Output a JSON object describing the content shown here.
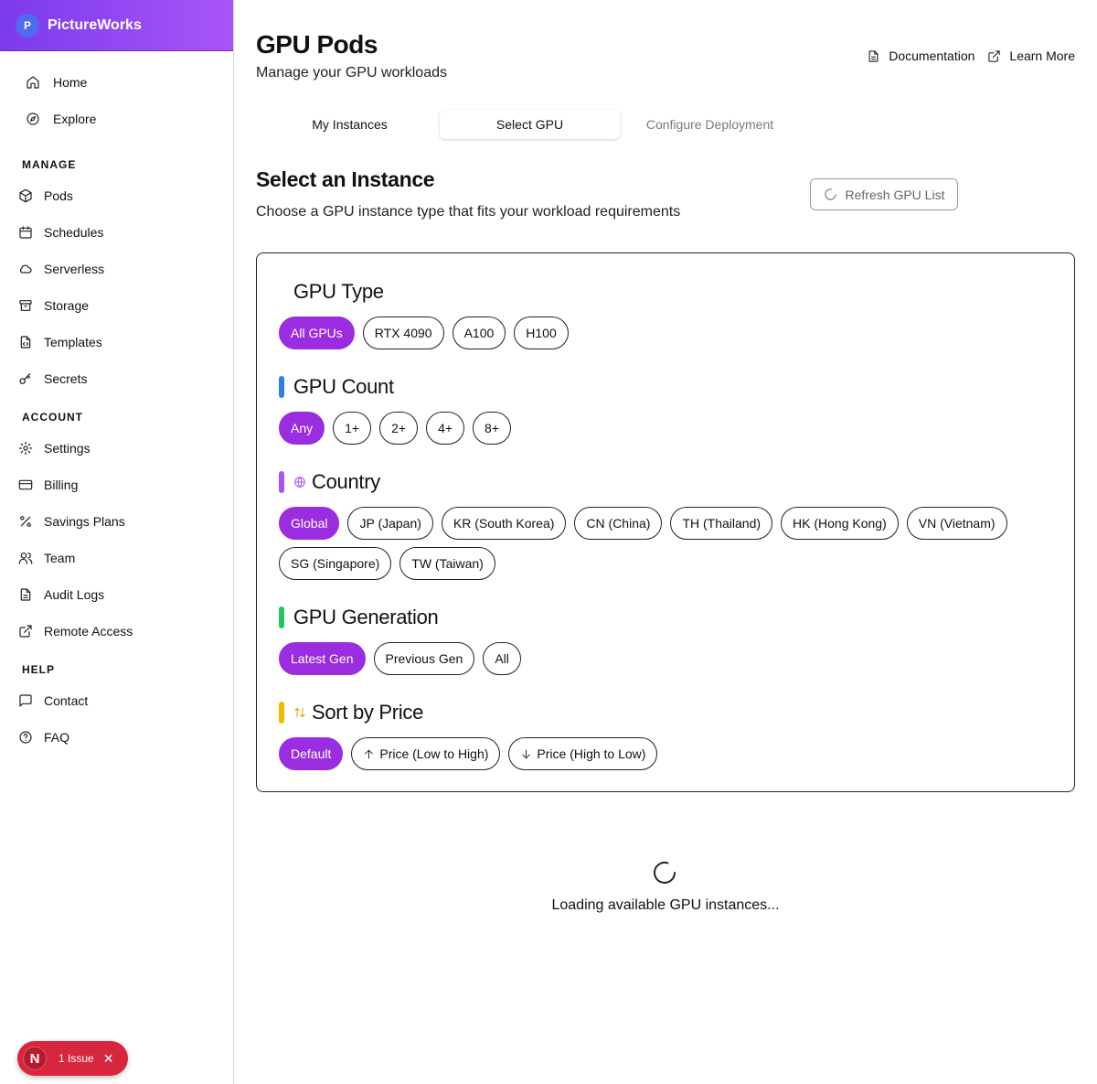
{
  "brand": {
    "initial": "P",
    "name": "PictureWorks"
  },
  "nav": {
    "top": [
      {
        "label": "Home",
        "icon": "home-icon"
      },
      {
        "label": "Explore",
        "icon": "compass-icon"
      }
    ],
    "manage_label": "MANAGE",
    "manage": [
      {
        "label": "Pods",
        "icon": "box-icon"
      },
      {
        "label": "Schedules",
        "icon": "calendar-icon"
      },
      {
        "label": "Serverless",
        "icon": "cloud-icon"
      },
      {
        "label": "Storage",
        "icon": "archive-icon"
      },
      {
        "label": "Templates",
        "icon": "file-code-icon"
      },
      {
        "label": "Secrets",
        "icon": "key-icon"
      }
    ],
    "account_label": "ACCOUNT",
    "account": [
      {
        "label": "Settings",
        "icon": "gear-icon"
      },
      {
        "label": "Billing",
        "icon": "credit-card-icon"
      },
      {
        "label": "Savings Plans",
        "icon": "percent-icon"
      },
      {
        "label": "Team",
        "icon": "users-icon"
      },
      {
        "label": "Audit Logs",
        "icon": "document-icon"
      },
      {
        "label": "Remote Access",
        "icon": "external-link-icon"
      }
    ],
    "help_label": "HELP",
    "help": [
      {
        "label": "Contact",
        "icon": "message-icon"
      },
      {
        "label": "FAQ",
        "icon": "help-circle-icon"
      }
    ]
  },
  "issue_badge": {
    "initial": "N",
    "text": "1 Issue",
    "close": "✕"
  },
  "header": {
    "title": "GPU Pods",
    "subtitle": "Manage your GPU workloads",
    "documentation": "Documentation",
    "learn_more": "Learn More"
  },
  "tabs": [
    {
      "label": "My Instances",
      "state": "normal"
    },
    {
      "label": "Select GPU",
      "state": "active"
    },
    {
      "label": "Configure Deployment",
      "state": "disabled"
    }
  ],
  "section": {
    "title": "Select an Instance",
    "subtitle": "Choose a GPU instance type that fits your workload requirements",
    "refresh": "Refresh GPU List"
  },
  "filters": {
    "gpu_type": {
      "label": "GPU Type",
      "options": [
        "All GPUs",
        "RTX 4090",
        "A100",
        "H100"
      ],
      "selected": "All GPUs"
    },
    "gpu_count": {
      "label": "GPU Count",
      "accent": "#2f80ed",
      "options": [
        "Any",
        "1+",
        "2+",
        "4+",
        "8+"
      ],
      "selected": "Any"
    },
    "country": {
      "label": "Country",
      "accent": "#a855f7",
      "icon": "globe-icon",
      "options": [
        "Global",
        "JP (Japan)",
        "KR (South Korea)",
        "CN (China)",
        "TH (Thailand)",
        "HK (Hong Kong)",
        "VN (Vietnam)",
        "SG (Singapore)",
        "TW (Taiwan)"
      ],
      "selected": "Global"
    },
    "gpu_generation": {
      "label": "GPU Generation",
      "accent": "#22c55e",
      "options": [
        "Latest Gen",
        "Previous Gen",
        "All"
      ],
      "selected": "Latest Gen"
    },
    "sort": {
      "label": "Sort by Price",
      "accent": "#f5b800",
      "icon": "sort-arrows-icon",
      "options": [
        "Default",
        "Price (Low to High)",
        "Price (High to Low)"
      ],
      "selected": "Default"
    }
  },
  "selected_color": "#9b2de0",
  "loading": {
    "text": "Loading available GPU instances..."
  }
}
